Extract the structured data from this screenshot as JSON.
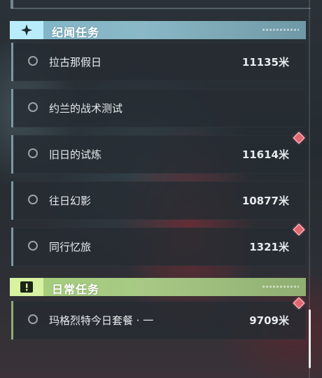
{
  "sections": [
    {
      "title": "纪闻任务",
      "icon": "sparkle-icon",
      "accent": "#8ab8c6",
      "quests": [
        {
          "name": "拉古那假日",
          "distance": "11135米",
          "tracked_marker": false
        },
        {
          "name": "约兰的战术测试",
          "distance": "",
          "tracked_marker": false
        },
        {
          "name": "旧日的试炼",
          "distance": "11614米",
          "tracked_marker": true
        },
        {
          "name": "往日幻影",
          "distance": "10877米",
          "tracked_marker": false
        },
        {
          "name": "同行忆旅",
          "distance": "1321米",
          "tracked_marker": true
        }
      ]
    },
    {
      "title": "日常任务",
      "icon": "exclamation-box-icon",
      "accent": "#a7c985",
      "quests": [
        {
          "name": "玛格烈特今日套餐 · 一",
          "distance": "9709米",
          "tracked_marker": true
        }
      ]
    }
  ],
  "colors": {
    "marker": "#e26672",
    "text": "#e7ebee"
  }
}
